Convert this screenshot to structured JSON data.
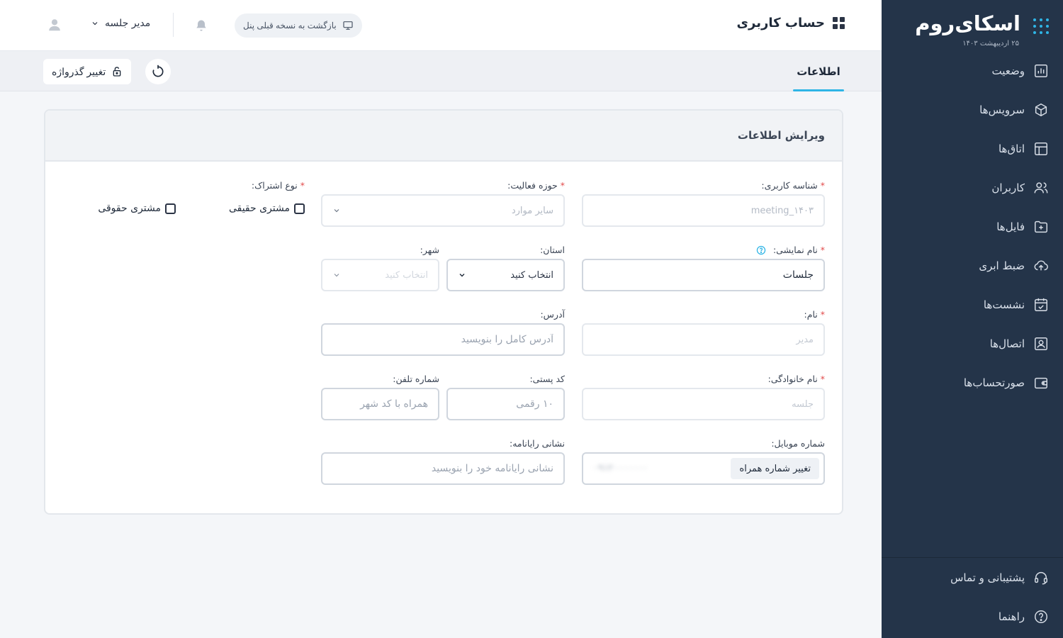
{
  "brand": {
    "name": "اسکای‌روم",
    "date": "۲۵ اردیبهشت ۱۴۰۳"
  },
  "sidebar": {
    "items": [
      {
        "label": "وضعیت",
        "icon": "chart-icon"
      },
      {
        "label": "سرویس‌ها",
        "icon": "cube-icon"
      },
      {
        "label": "اتاق‌ها",
        "icon": "layout-icon"
      },
      {
        "label": "کاربران",
        "icon": "users-icon"
      },
      {
        "label": "فایل‌ها",
        "icon": "folder-plus-icon"
      },
      {
        "label": "ضبط ابری",
        "icon": "cloud-upload-icon"
      },
      {
        "label": "نشست‌ها",
        "icon": "calendar-check-icon"
      },
      {
        "label": "اتصال‌ها",
        "icon": "contact-icon"
      },
      {
        "label": "صورتحساب‌ها",
        "icon": "wallet-icon"
      }
    ],
    "bottom": [
      {
        "label": "پشتیبانی و تماس",
        "icon": "headset-icon"
      },
      {
        "label": "راهنما",
        "icon": "help-icon"
      }
    ]
  },
  "header": {
    "title": "حساب کاربری",
    "back_label": "بازگشت به نسخه قبلی پنل",
    "user_name": "مدیر جلسه"
  },
  "tabs": {
    "active": "اطلاعات",
    "change_password": "تغییر گذرواژه"
  },
  "form": {
    "title": "ویرایش اطلاعات",
    "username": {
      "label": "شناسه کاربری:",
      "value": "meeting_۱۴۰۳"
    },
    "activity": {
      "label": "حوزه فعالیت:",
      "placeholder": "سایر موارد"
    },
    "subscription": {
      "label": "نوع اشتراک:",
      "option_real": "مشتری حقیقی",
      "option_legal": "مشتری حقوقی"
    },
    "display_name": {
      "label": "نام نمایشی:",
      "value": "جلسات"
    },
    "province": {
      "label": "استان:",
      "value": "انتخاب کنید"
    },
    "city": {
      "label": "شهر:",
      "value": "انتخاب کنید"
    },
    "first_name": {
      "label": "نام:",
      "placeholder": "مدیر"
    },
    "address": {
      "label": "آدرس:",
      "placeholder": "آدرس کامل را بنویسید"
    },
    "last_name": {
      "label": "نام خانوادگی:",
      "placeholder": "جلسه"
    },
    "postal": {
      "label": "کد پستی:",
      "placeholder": "۱۰ رقمی"
    },
    "phone": {
      "label": "شماره تلفن:",
      "placeholder": "همراه با کد شهر"
    },
    "mobile": {
      "label": "شماره موبایل:",
      "value": "۰۹۱۲۰۰۰۰۰۰۰",
      "change_label": "تغییر شماره همراه"
    },
    "email": {
      "label": "نشانی رایانامه:",
      "placeholder": "نشانی رایانامه خود را بنویسید"
    }
  },
  "colors": {
    "sidebar_bg": "#243449",
    "accent": "#2fb5e6",
    "required": "#e24b4b"
  }
}
